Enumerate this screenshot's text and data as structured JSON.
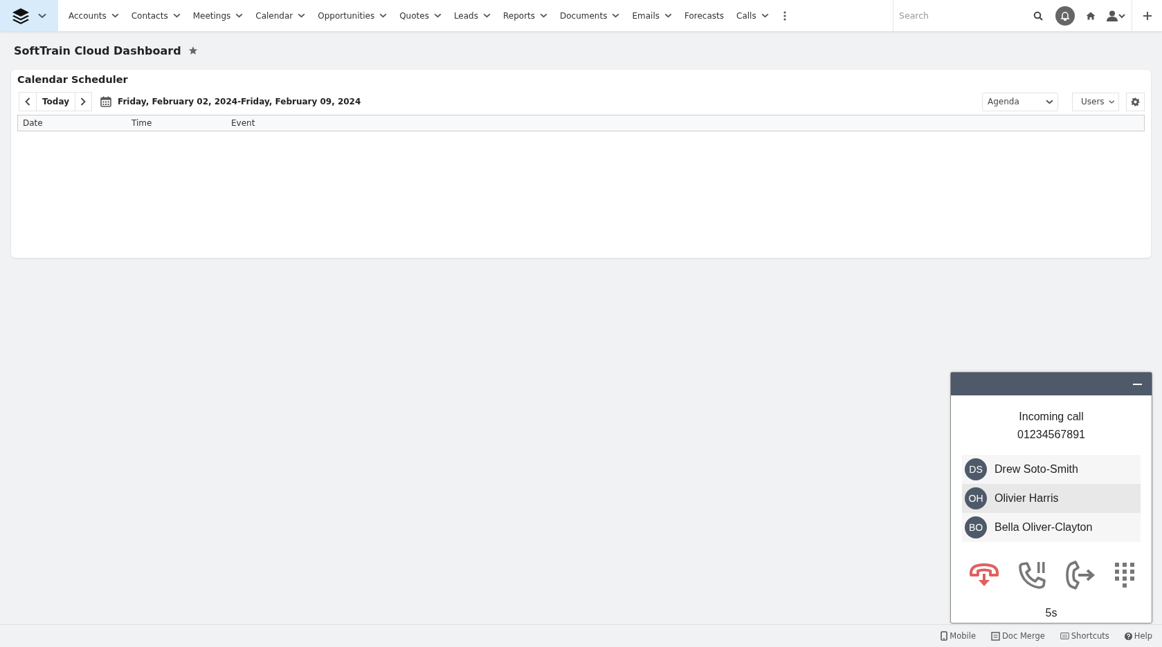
{
  "nav": {
    "items": [
      {
        "label": "Accounts",
        "dropdown": true
      },
      {
        "label": "Contacts",
        "dropdown": true
      },
      {
        "label": "Meetings",
        "dropdown": true
      },
      {
        "label": "Calendar",
        "dropdown": true
      },
      {
        "label": "Opportunities",
        "dropdown": true
      },
      {
        "label": "Quotes",
        "dropdown": true
      },
      {
        "label": "Leads",
        "dropdown": true
      },
      {
        "label": "Reports",
        "dropdown": true
      },
      {
        "label": "Documents",
        "dropdown": true
      },
      {
        "label": "Emails",
        "dropdown": true
      },
      {
        "label": "Forecasts",
        "dropdown": false
      },
      {
        "label": "Calls",
        "dropdown": true
      }
    ],
    "search": {
      "placeholder": "Search"
    }
  },
  "page": {
    "title": "SoftTrain Cloud Dashboard"
  },
  "dashlet": {
    "title": "Calendar Scheduler",
    "today": "Today",
    "range": "Friday, February 02, 2024-Friday, February 09, 2024",
    "view": "Agenda",
    "users": "Users",
    "columns": [
      "Date",
      "Time",
      "Event"
    ]
  },
  "call": {
    "status": "Incoming call",
    "number": "01234567891",
    "contacts": [
      {
        "initials": "DS",
        "name": "Drew Soto-Smith",
        "selected": false
      },
      {
        "initials": "OH",
        "name": "Olivier Harris",
        "selected": true
      },
      {
        "initials": "BO",
        "name": "Bella Oliver-Clayton",
        "selected": false
      }
    ],
    "timer": "5s"
  },
  "footer": {
    "links": [
      {
        "kind": "mobile",
        "label": "Mobile"
      },
      {
        "kind": "docmerge",
        "label": "Doc Merge"
      },
      {
        "kind": "shortcuts",
        "label": "Shortcuts"
      },
      {
        "kind": "help",
        "label": "Help"
      }
    ]
  }
}
